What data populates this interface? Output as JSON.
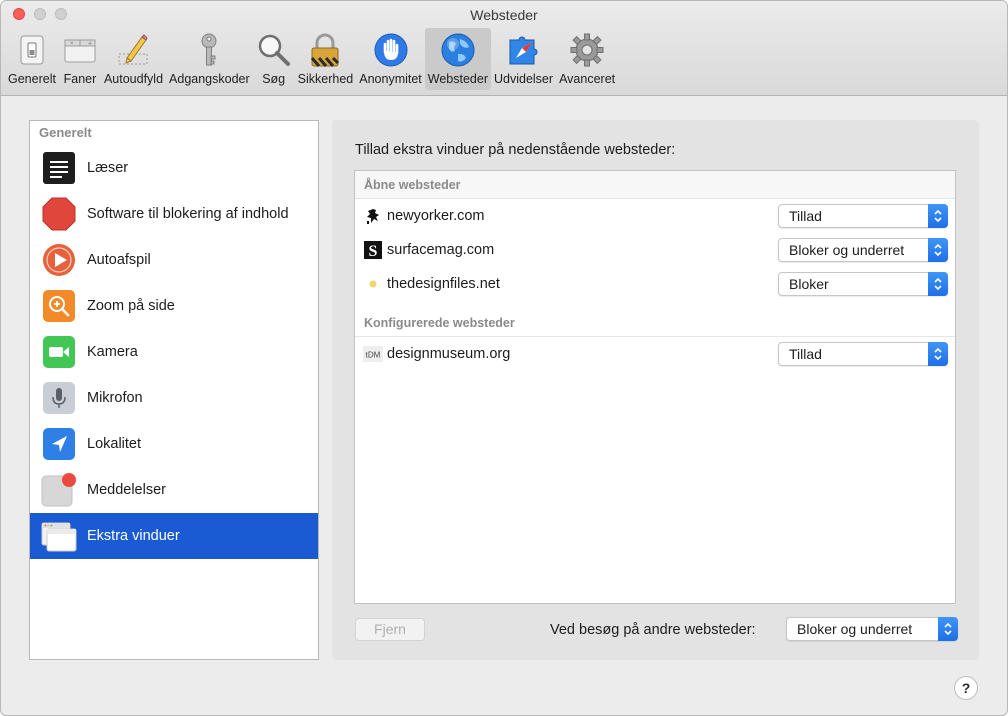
{
  "window": {
    "title": "Websteder"
  },
  "toolbar": {
    "items": [
      {
        "label": "Generelt",
        "icon": "switch-icon"
      },
      {
        "label": "Faner",
        "icon": "tabs-icon"
      },
      {
        "label": "Autoudfyld",
        "icon": "pencil-icon"
      },
      {
        "label": "Adgangskoder",
        "icon": "key-icon"
      },
      {
        "label": "Søg",
        "icon": "magnifier-icon"
      },
      {
        "label": "Sikkerhed",
        "icon": "lock-icon"
      },
      {
        "label": "Anonymitet",
        "icon": "hand-icon"
      },
      {
        "label": "Websteder",
        "icon": "globe-icon",
        "active": true
      },
      {
        "label": "Udvidelser",
        "icon": "puzzle-icon"
      },
      {
        "label": "Avanceret",
        "icon": "gear-icon"
      }
    ]
  },
  "sidebar": {
    "header": "Generelt",
    "items": [
      {
        "label": "Læser",
        "icon": "reader-icon"
      },
      {
        "label": "Software til blokering af indhold",
        "icon": "stop-sign-icon"
      },
      {
        "label": "Autoafspil",
        "icon": "play-icon"
      },
      {
        "label": "Zoom på side",
        "icon": "zoom-icon"
      },
      {
        "label": "Kamera",
        "icon": "camera-icon"
      },
      {
        "label": "Mikrofon",
        "icon": "microphone-icon"
      },
      {
        "label": "Lokalitet",
        "icon": "location-arrow-icon"
      },
      {
        "label": "Meddelelser",
        "icon": "notifications-icon"
      },
      {
        "label": "Ekstra vinduer",
        "icon": "popup-windows-icon",
        "selected": true
      }
    ]
  },
  "pane": {
    "title": "Tillad ekstra vinduer på nedenstående websteder:",
    "open_header": "Åbne websteder",
    "open_sites": [
      {
        "site": "newyorker.com",
        "setting": "Tillad",
        "favicon": "newyorker-favicon"
      },
      {
        "site": "surfacemag.com",
        "setting": "Bloker og underret",
        "favicon": "surfacemag-favicon"
      },
      {
        "site": "thedesignfiles.net",
        "setting": "Bloker",
        "favicon": "dot-favicon"
      }
    ],
    "configured_header": "Konfigurerede websteder",
    "configured_sites": [
      {
        "site": "designmuseum.org",
        "setting": "Tillad",
        "favicon": "designmuseum-favicon",
        "favicon_text": "tDM"
      }
    ],
    "remove_label": "Fjern",
    "other_label": "Ved besøg på andre websteder:",
    "other_setting": "Bloker og underret"
  },
  "help": {
    "label": "?"
  },
  "colors": {
    "accent": "#1a5bd3",
    "close": "#fc5f57",
    "select_arrow": "#2a7ef0"
  }
}
